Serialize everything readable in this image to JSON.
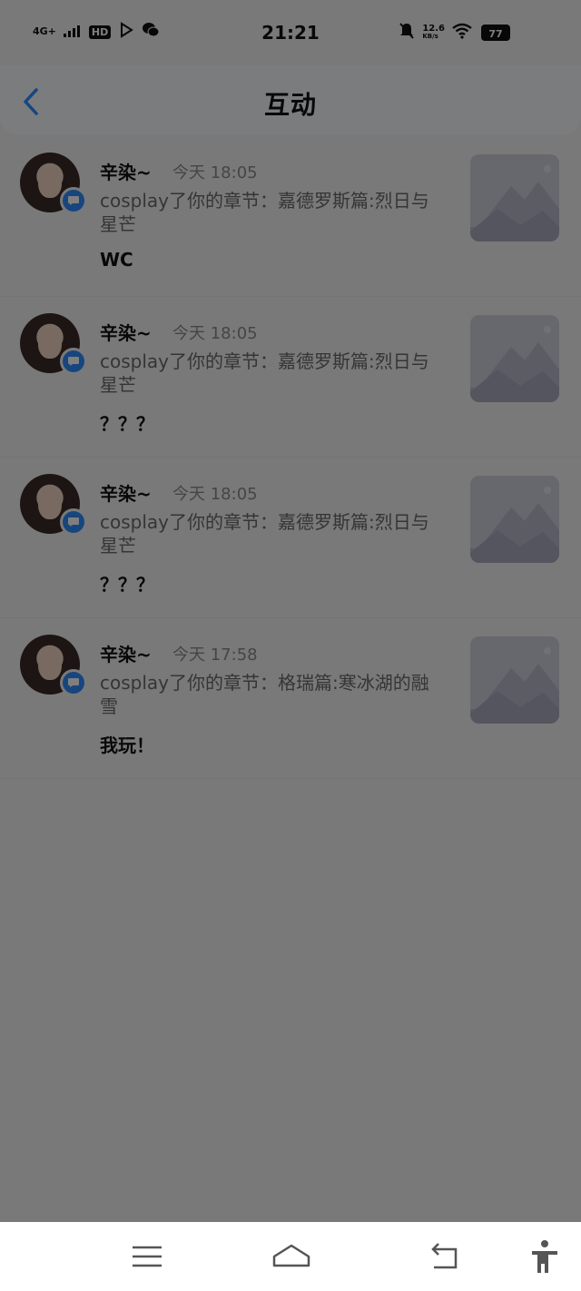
{
  "status": {
    "network": "4G+",
    "hd": "HD",
    "time": "21:21",
    "speed_value": "12.6",
    "speed_unit": "KB/s",
    "battery": "77"
  },
  "header": {
    "title": "互动"
  },
  "items": [
    {
      "name": "辛染~",
      "time": "今天 18:05",
      "text": "cosplay了你的章节：嘉德罗斯篇:烈日与星芒",
      "reply": "WC"
    },
    {
      "name": "辛染~",
      "time": "今天 18:05",
      "text": "cosplay了你的章节：嘉德罗斯篇:烈日与星芒",
      "reply": "？？？"
    },
    {
      "name": "辛染~",
      "time": "今天 18:05",
      "text": "cosplay了你的章节：嘉德罗斯篇:烈日与星芒",
      "reply": "？？？"
    },
    {
      "name": "辛染~",
      "time": "今天 17:58",
      "text": "cosplay了你的章节：格瑞篇:寒冰湖的融雪",
      "reply": "我玩！"
    }
  ],
  "icons": {
    "back": "chevron-left-icon",
    "badge": "chat-bubble-icon",
    "menu": "menu-icon",
    "home": "home-icon",
    "return": "back-icon",
    "accessibility": "accessibility-icon"
  },
  "colors": {
    "accent": "#2f8cff",
    "backdrop": "#797979"
  }
}
